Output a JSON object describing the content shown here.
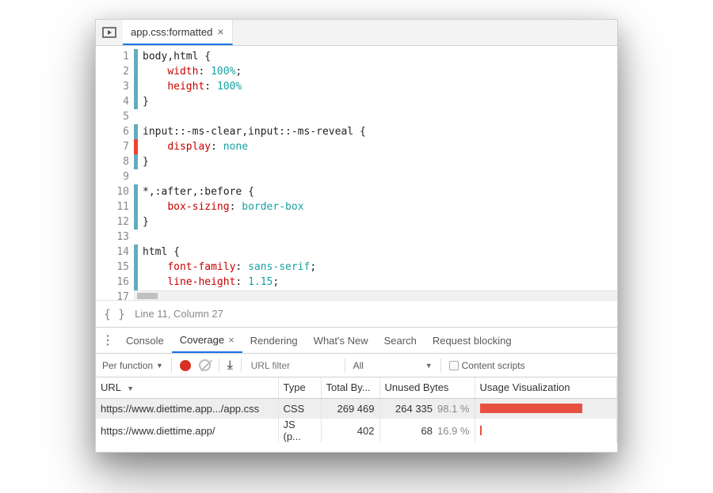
{
  "tab": {
    "title": "app.css:formatted"
  },
  "code": {
    "lines": [
      {
        "n": 1,
        "cov": "g",
        "html": "<span class='sel'>body,html</span> <span class='pun'>{</span>"
      },
      {
        "n": 2,
        "cov": "g",
        "html": "    <span class='prop'>width</span><span class='pun'>:</span> <span class='val'>100%</span><span class='pun'>;</span>"
      },
      {
        "n": 3,
        "cov": "g",
        "html": "    <span class='prop'>height</span><span class='pun'>:</span> <span class='val'>100%</span>"
      },
      {
        "n": 4,
        "cov": "g",
        "html": "<span class='pun'>}</span>"
      },
      {
        "n": 5,
        "cov": "",
        "html": ""
      },
      {
        "n": 6,
        "cov": "g",
        "html": "<span class='sel'>input::-ms-clear,input::-ms-reveal</span> <span class='pun'>{</span>"
      },
      {
        "n": 7,
        "cov": "r",
        "html": "    <span class='prop'>display</span><span class='pun'>:</span> <span class='val'>none</span>"
      },
      {
        "n": 8,
        "cov": "g",
        "html": "<span class='pun'>}</span>"
      },
      {
        "n": 9,
        "cov": "",
        "html": ""
      },
      {
        "n": 10,
        "cov": "g",
        "html": "<span class='sel'>*,:after,:before</span> <span class='pun'>{</span>"
      },
      {
        "n": 11,
        "cov": "g",
        "html": "    <span class='prop'>box-sizing</span><span class='pun'>:</span> <span class='val'>border-box</span>"
      },
      {
        "n": 12,
        "cov": "g",
        "html": "<span class='pun'>}</span>"
      },
      {
        "n": 13,
        "cov": "",
        "html": ""
      },
      {
        "n": 14,
        "cov": "g",
        "html": "<span class='sel'>html</span> <span class='pun'>{</span>"
      },
      {
        "n": 15,
        "cov": "g",
        "html": "    <span class='prop'>font-family</span><span class='pun'>:</span> <span class='val'>sans-serif</span><span class='pun'>;</span>"
      },
      {
        "n": 16,
        "cov": "g",
        "html": "    <span class='prop'>line-height</span><span class='pun'>:</span> <span class='val'>1.15</span><span class='pun'>;</span>"
      },
      {
        "n": 17,
        "cov": "g",
        "html": ""
      }
    ]
  },
  "status": {
    "cursor": "Line 11, Column 27"
  },
  "drawer": {
    "tabs": [
      "Console",
      "Coverage",
      "Rendering",
      "What's New",
      "Search",
      "Request blocking"
    ],
    "active": "Coverage"
  },
  "coverage": {
    "toolbar": {
      "mode": "Per function",
      "url_filter_placeholder": "URL filter",
      "type_filter": "All",
      "content_scripts_label": "Content scripts"
    },
    "columns": {
      "url": "URL",
      "type": "Type",
      "total": "Total By...",
      "unused": "Unused Bytes",
      "viz": "Usage Visualization"
    },
    "rows": [
      {
        "url": "https://www.diettime.app.../app.css",
        "type": "CSS",
        "total": "269 469",
        "unused": "264 335",
        "pct": "98.1 %",
        "bar": 78,
        "selected": true
      },
      {
        "url": "https://www.diettime.app/",
        "type": "JS (p...",
        "total": "402",
        "unused": "68",
        "pct": "16.9 %",
        "bar": 1,
        "selected": false
      }
    ]
  }
}
